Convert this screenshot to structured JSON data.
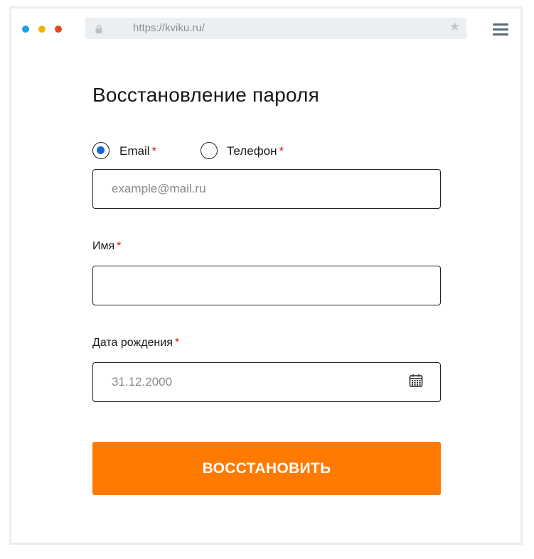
{
  "browser": {
    "dots": [
      "#1aa3e8",
      "#f5b400",
      "#e8471f"
    ],
    "url": "https://kviku.ru/"
  },
  "form": {
    "title": "Восстановление пароля",
    "contact_type": {
      "options": [
        {
          "label": "Email",
          "required": "*",
          "selected": true
        },
        {
          "label": "Телефон",
          "required": "*",
          "selected": false
        }
      ]
    },
    "email": {
      "placeholder": "example@mail.ru",
      "value": ""
    },
    "name": {
      "label": "Имя",
      "required": "*",
      "value": ""
    },
    "birthdate": {
      "label": "Дата рождения",
      "required": "*",
      "placeholder": "31.12.2000"
    },
    "submit_label": "ВОССТАНОВИТЬ"
  },
  "colors": {
    "accent": "#ff7a00",
    "radio_selected": "#1568c9",
    "required": "#d01616"
  }
}
